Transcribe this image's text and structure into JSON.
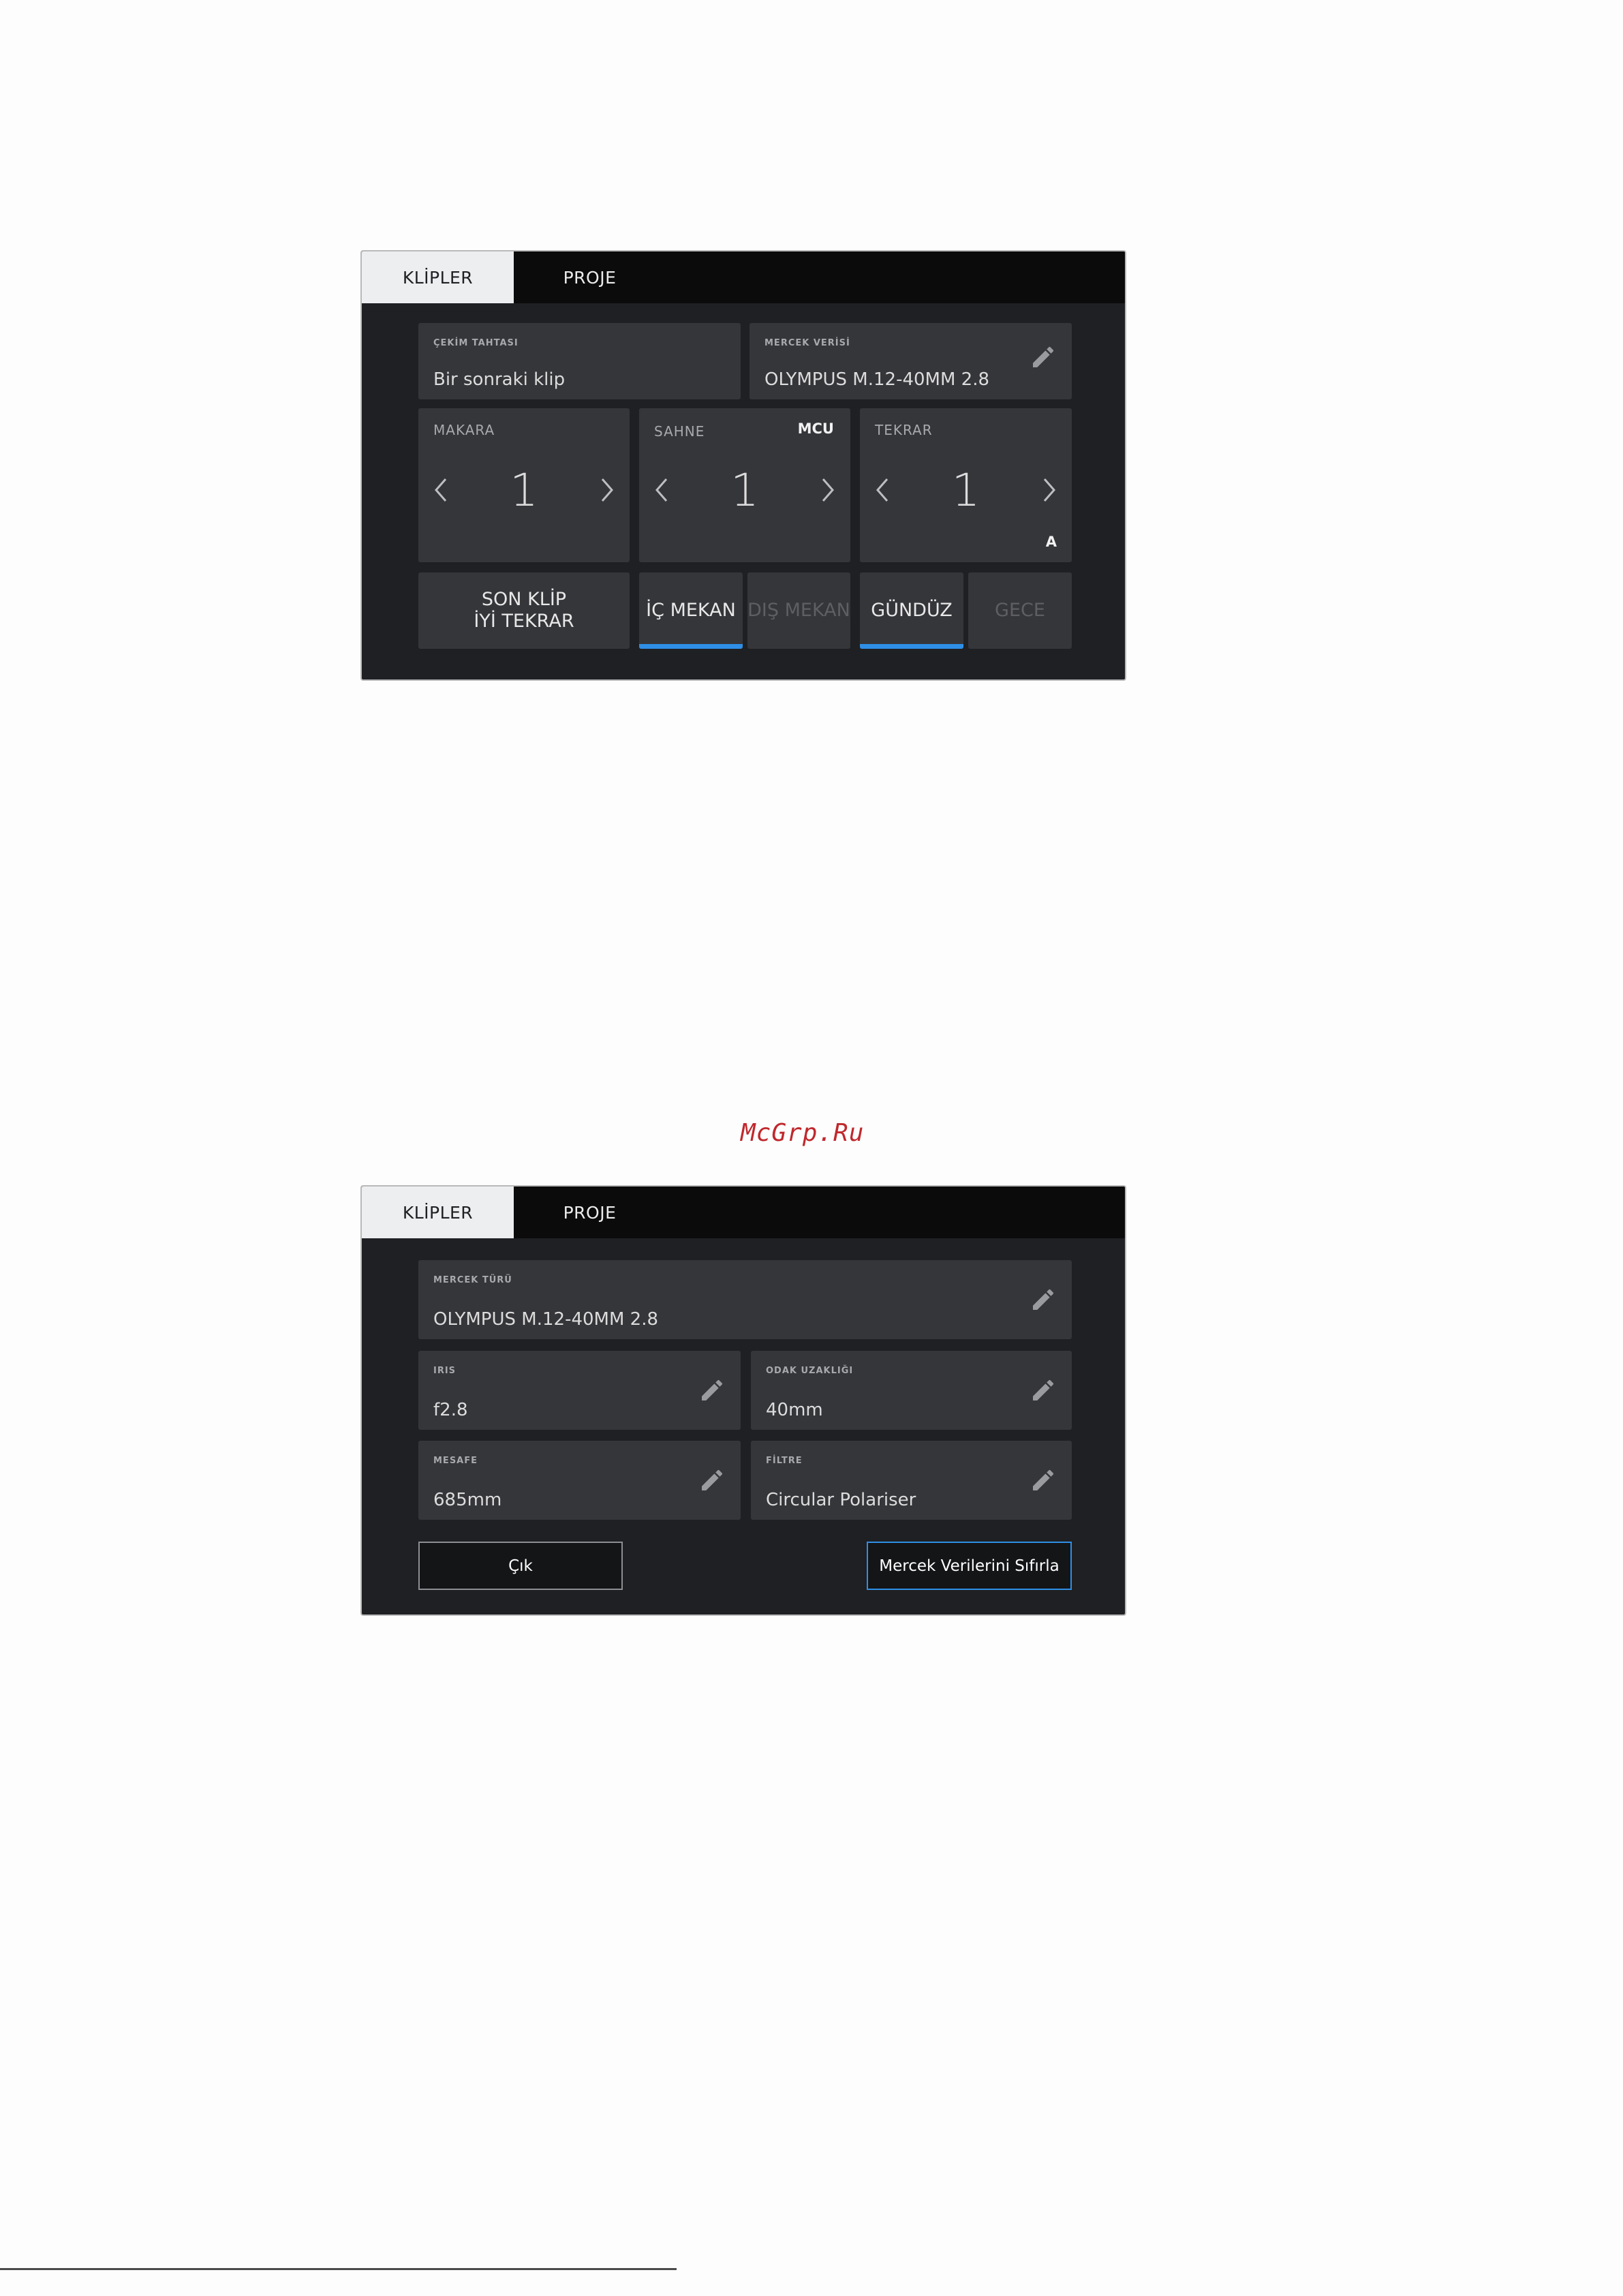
{
  "screen1": {
    "tabs": [
      {
        "label": "KLİPLER",
        "active": true
      },
      {
        "label": "PROJE",
        "active": false
      }
    ],
    "slate": {
      "caption": "ÇEKİM TAHTASI",
      "value": "Bir sonraki klip"
    },
    "lens_data": {
      "caption": "MERCEK VERİSİ",
      "value": "OLYMPUS M.12-40MM 2.8"
    },
    "reel": {
      "caption": "MAKARA",
      "value": "1"
    },
    "scene": {
      "caption": "SAHNE",
      "value": "1",
      "tag": "MCU"
    },
    "take": {
      "caption": "TEKRAR",
      "value": "1",
      "tag": "A"
    },
    "buttons": {
      "good_take": "SON KLİP\nİYİ TEKRAR",
      "interior": "İÇ MEKAN",
      "exterior": "DIŞ MEKAN",
      "day": "GÜNDÜZ",
      "night": "GECE"
    },
    "toggles": {
      "interior": true,
      "exterior": false,
      "day": true,
      "night": false
    }
  },
  "watermark": "McGrp.Ru",
  "screen2": {
    "tabs": [
      {
        "label": "KLİPLER",
        "active": true
      },
      {
        "label": "PROJE",
        "active": false
      }
    ],
    "lens_type": {
      "caption": "MERCEK TÜRÜ",
      "value": "OLYMPUS M.12-40MM 2.8"
    },
    "iris": {
      "caption": "IRIS",
      "value": "f2.8"
    },
    "focal_length": {
      "caption": "ODAK UZAKLIĞI",
      "value": "40mm"
    },
    "distance": {
      "caption": "MESAFE",
      "value": "685mm"
    },
    "filter": {
      "caption": "FİLTRE",
      "value": "Circular Polariser"
    },
    "exit_button": "Çık",
    "reset_button": "Mercek Verilerini Sıfırla"
  },
  "colors": {
    "accent": "#2f8fe6",
    "panel": "#1f2023",
    "field": "#35363a",
    "tabbar": "#0b0b0c"
  }
}
